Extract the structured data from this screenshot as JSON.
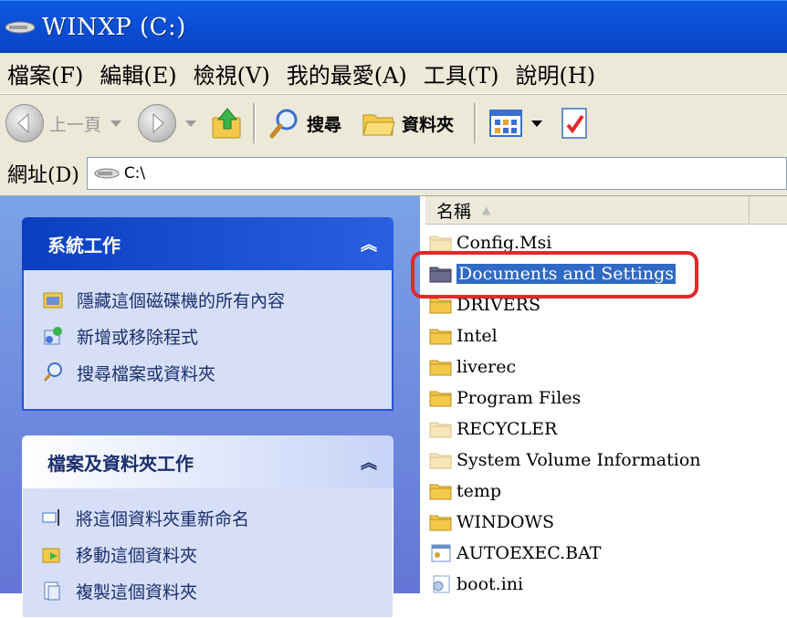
{
  "window": {
    "title": "WINXP (C:)"
  },
  "menu": [
    "檔案(F)",
    "編輯(E)",
    "檢視(V)",
    "我的最愛(A)",
    "工具(T)",
    "說明(H)"
  ],
  "toolbar": {
    "back_label": "上一頁",
    "search_label": "搜尋",
    "folders_label": "資料夾"
  },
  "address": {
    "label": "網址(D)",
    "path": "C:\\"
  },
  "system_tasks": {
    "title": "系統工作",
    "items": [
      "隱藏這個磁碟機的所有內容",
      "新增或移除程式",
      "搜尋檔案或資料夾"
    ]
  },
  "folder_tasks": {
    "title": "檔案及資料夾工作",
    "items": [
      "將這個資料夾重新命名",
      "移動這個資料夾",
      "複製這個資料夾"
    ]
  },
  "columns": {
    "name": "名稱"
  },
  "files": [
    {
      "name": "Config.Msi",
      "type": "folder-hidden"
    },
    {
      "name": "Documents and Settings",
      "type": "folder-selected"
    },
    {
      "name": "DRIVERS",
      "type": "folder"
    },
    {
      "name": "Intel",
      "type": "folder"
    },
    {
      "name": "liverec",
      "type": "folder"
    },
    {
      "name": "Program Files",
      "type": "folder"
    },
    {
      "name": "RECYCLER",
      "type": "folder-hidden"
    },
    {
      "name": "System Volume Information",
      "type": "folder-hidden"
    },
    {
      "name": "temp",
      "type": "folder"
    },
    {
      "name": "WINDOWS",
      "type": "folder"
    },
    {
      "name": "AUTOEXEC.BAT",
      "type": "bat"
    },
    {
      "name": "boot.ini",
      "type": "ini"
    }
  ],
  "colors": {
    "title_blue": "#0b4fd6",
    "selection": "#316ac5",
    "highlight_red": "#e02a2a"
  }
}
